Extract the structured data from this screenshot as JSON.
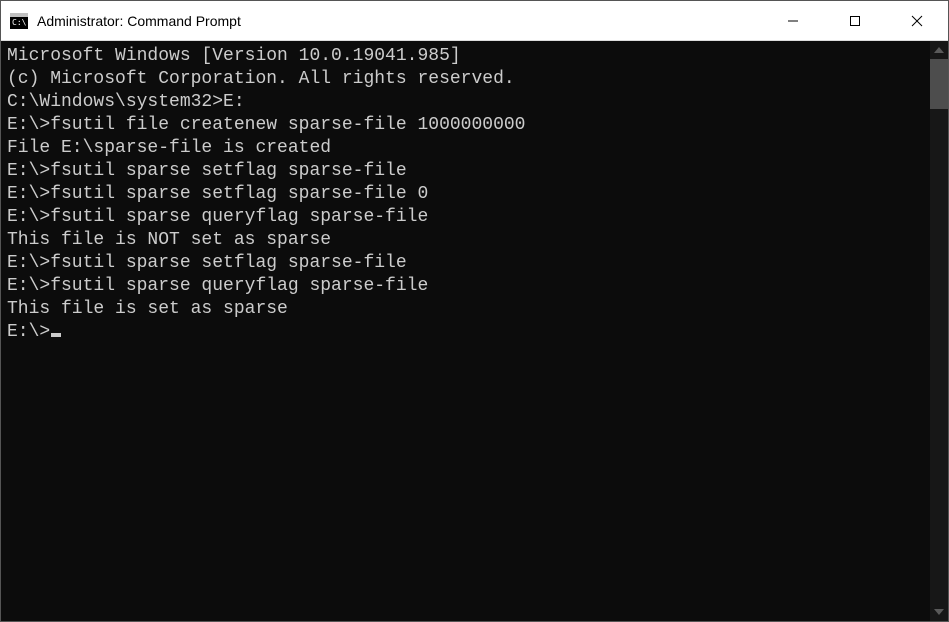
{
  "titlebar": {
    "title": "Administrator: Command Prompt"
  },
  "console": {
    "lines": [
      "Microsoft Windows [Version 10.0.19041.985]",
      "(c) Microsoft Corporation. All rights reserved.",
      "",
      "C:\\Windows\\system32>E:",
      "",
      "E:\\>fsutil file createnew sparse-file 1000000000",
      "File E:\\sparse-file is created",
      "",
      "E:\\>fsutil sparse setflag sparse-file",
      "",
      "E:\\>fsutil sparse setflag sparse-file 0",
      "",
      "E:\\>fsutil sparse queryflag sparse-file",
      "This file is NOT set as sparse",
      "",
      "E:\\>fsutil sparse setflag sparse-file",
      "",
      "E:\\>fsutil sparse queryflag sparse-file",
      "This file is set as sparse",
      "",
      "E:\\>"
    ]
  }
}
